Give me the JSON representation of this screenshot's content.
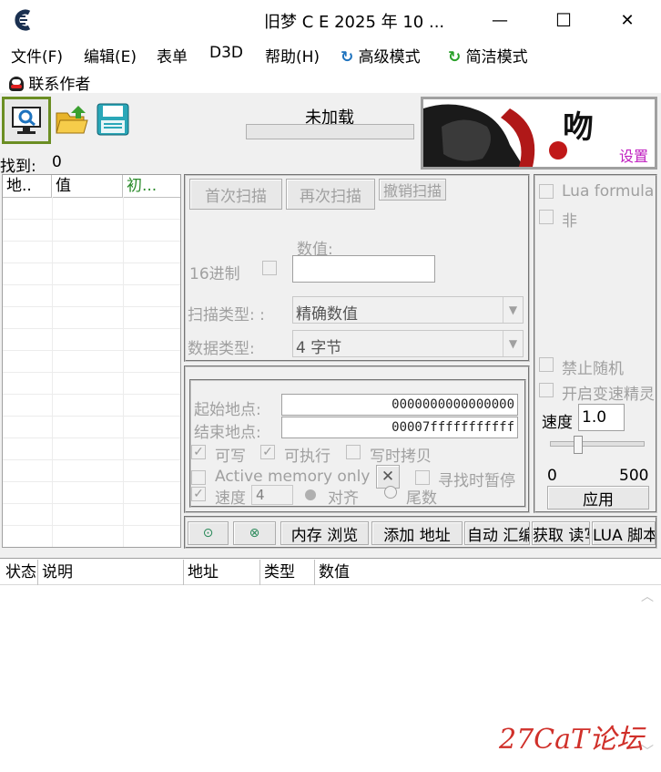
{
  "titlebar": {
    "title": "旧梦 C E    2025 年  10 ...",
    "minimize": "—",
    "maximize": "☐",
    "close": "✕"
  },
  "menu": {
    "file": "文件(F)",
    "edit": "编辑(E)",
    "table": "表单",
    "d3d": "D3D",
    "help": "帮助(H)",
    "advanced": "高级模式",
    "simple": "简洁模式",
    "contact": "联系作者"
  },
  "status": {
    "process": "未加载",
    "found_label": "找到:",
    "found_count": "0",
    "settings": "设置"
  },
  "result_list": {
    "columns": [
      "地..",
      "值",
      "初..."
    ]
  },
  "scan": {
    "first_scan": "首次扫描",
    "next_scan": "再次扫描",
    "undo_scan": "撤销扫描",
    "value_label": "数值:",
    "hex_label": "16进制",
    "value_input": "",
    "scan_type_label": "扫描类型: :",
    "scan_type_value": "精确数值",
    "data_type_label": "数据类型:",
    "data_type_value": "4 字节"
  },
  "memory": {
    "start_label": "起始地点:",
    "start_value": "0000000000000000",
    "end_label": "结束地点:",
    "end_value": "00007fffffffffff",
    "writable": "可写",
    "executable": "可执行",
    "copy_on_write": "写时拷贝",
    "active_memory": "Active memory only",
    "pause_on_scan": "寻找时暂停",
    "speed_label": "速度",
    "speed_value": "4",
    "align": "对齐",
    "last_digits": "尾数"
  },
  "right_panel": {
    "lua_formula": "Lua formula",
    "not": "非",
    "no_random": "禁止随机",
    "speedhack": "开启变速精灵",
    "speed_label": "速度",
    "speed_value": "1.0",
    "slider_min": "0",
    "slider_max": "500",
    "apply": "应用"
  },
  "toolbar2": {
    "memory_view": "内存 浏览",
    "add_address": "添加 地址",
    "auto_asm": "自动 汇编",
    "read_write": "获取 读写",
    "lua_script": "LUA 脚本"
  },
  "cheat_table": {
    "columns": [
      "状态",
      "说明",
      "地址",
      "类型",
      "数值"
    ]
  },
  "watermark": "27CaT论坛",
  "colors": {
    "accent_green": "#6b8e23",
    "blue_icon": "#1e73be",
    "watermark_red": "#d0302a"
  }
}
